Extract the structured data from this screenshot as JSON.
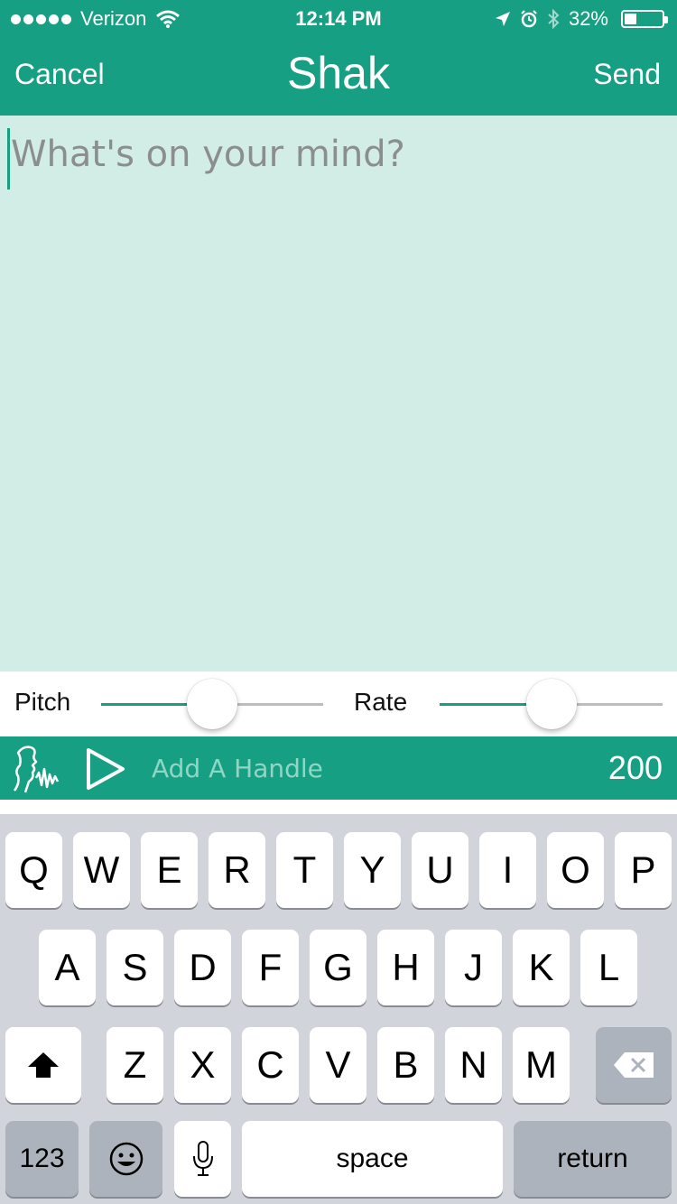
{
  "status_bar": {
    "carrier": "Verizon",
    "time": "12:14 PM",
    "battery": "32%",
    "battery_level": 0.32
  },
  "nav": {
    "cancel_label": "Cancel",
    "title": "Shak",
    "send_label": "Send"
  },
  "compose": {
    "placeholder": "What's on your mind?",
    "value": ""
  },
  "sliders": {
    "pitch_label": "Pitch",
    "pitch_value": 0.5,
    "rate_label": "Rate",
    "rate_value": 0.5
  },
  "handle_bar": {
    "voice_icon": "voice-waveform-icon",
    "play_icon": "play-icon",
    "handle_placeholder": "Add A Handle",
    "char_count": "200"
  },
  "keyboard": {
    "row1": [
      "Q",
      "W",
      "E",
      "R",
      "T",
      "Y",
      "U",
      "I",
      "O",
      "P"
    ],
    "row2": [
      "A",
      "S",
      "D",
      "F",
      "G",
      "H",
      "J",
      "K",
      "L"
    ],
    "row3": [
      "Z",
      "X",
      "C",
      "V",
      "B",
      "N",
      "M"
    ],
    "numbers_label": "123",
    "space_label": "space",
    "return_label": "return"
  },
  "colors": {
    "brand": "#179f84",
    "compose_bg": "#d2ece6",
    "keyboard_bg": "#d1d5db"
  }
}
